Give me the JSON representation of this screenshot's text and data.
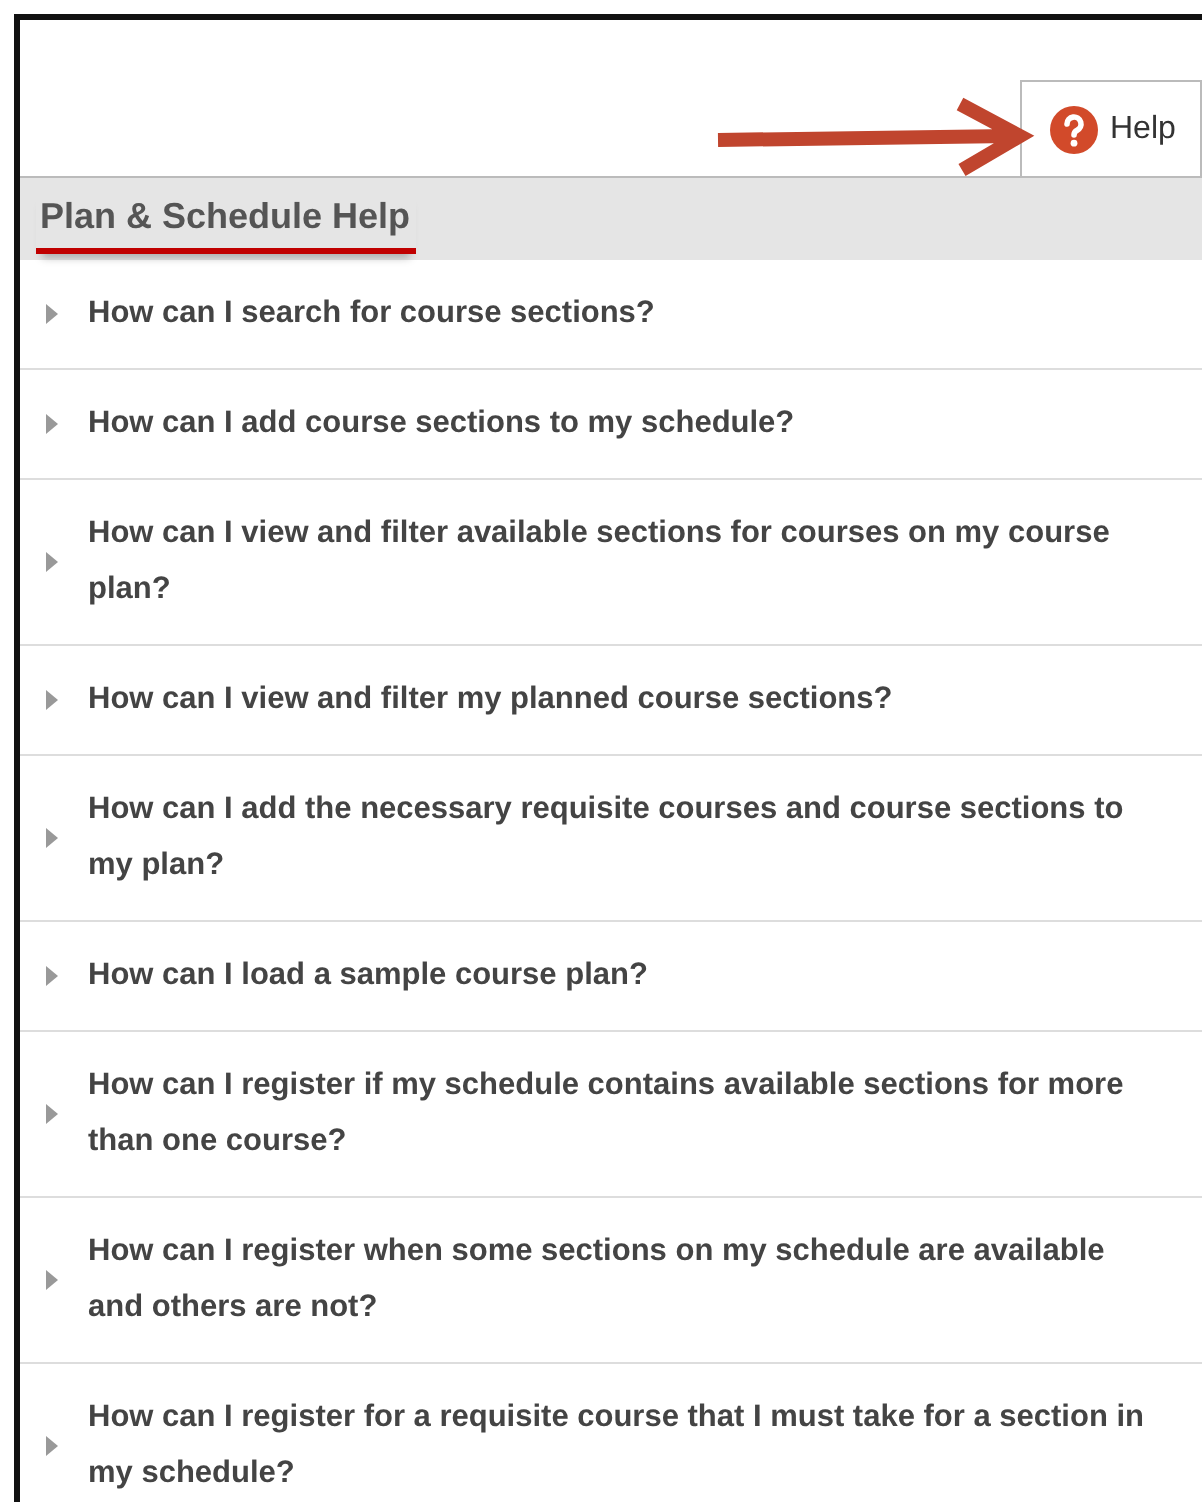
{
  "help_tab": {
    "label": "Help"
  },
  "panel": {
    "title": "Plan & Schedule Help"
  },
  "questions": [
    {
      "text": "How can I search for course sections?",
      "expanded": false
    },
    {
      "text": "How can I add course sections to my schedule?",
      "expanded": false
    },
    {
      "text": "How can I view and filter available sections for courses on my course plan?",
      "expanded": false
    },
    {
      "text": "How can I view and filter my planned course sections?",
      "expanded": false
    },
    {
      "text": "How can I add the necessary requisite courses and course sections to my plan?",
      "expanded": false
    },
    {
      "text": "How can I load a sample course plan?",
      "expanded": false
    },
    {
      "text": "How can I register if my schedule contains available sections for more than one course?",
      "expanded": false
    },
    {
      "text": "How can I register when some sections on my schedule are available and others are not?",
      "expanded": false
    },
    {
      "text": "How can I register for a requisite course that I must take for a section in my schedule?",
      "expanded": false
    }
  ]
}
